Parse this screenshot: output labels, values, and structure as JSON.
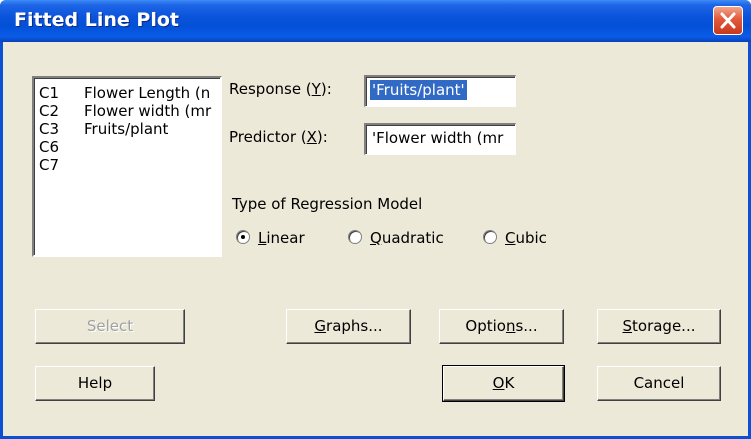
{
  "window": {
    "title": "Fitted Line Plot",
    "close_icon": "close-icon"
  },
  "variables": [
    {
      "col": "C1",
      "name": "Flower Length (n"
    },
    {
      "col": "C2",
      "name": "Flower width (mr"
    },
    {
      "col": "C3",
      "name": "Fruits/plant"
    },
    {
      "col": "C6",
      "name": ""
    },
    {
      "col": "C7",
      "name": ""
    }
  ],
  "response": {
    "label_pre": "Response (",
    "label_key": "Y",
    "label_post": "):",
    "value": "'Fruits/plant'"
  },
  "predictor": {
    "label_pre": "Predictor (",
    "label_key": "X",
    "label_post": "):",
    "value": "'Flower width (mr"
  },
  "model": {
    "label": "Type of Regression Model",
    "options": [
      {
        "key": "L",
        "rest": "inear",
        "selected": true
      },
      {
        "key": "Q",
        "rest": "uadratic",
        "selected": false
      },
      {
        "key": "C",
        "rest": "ubic",
        "selected": false
      }
    ]
  },
  "buttons": {
    "select": "Select",
    "graphs_key": "G",
    "graphs_rest": "raphs...",
    "options_pre": "Optio",
    "options_key": "n",
    "options_rest": "s...",
    "storage_key": "S",
    "storage_rest": "torage...",
    "help": "Help",
    "ok_key": "O",
    "ok_rest": "K",
    "cancel": "Cancel"
  }
}
